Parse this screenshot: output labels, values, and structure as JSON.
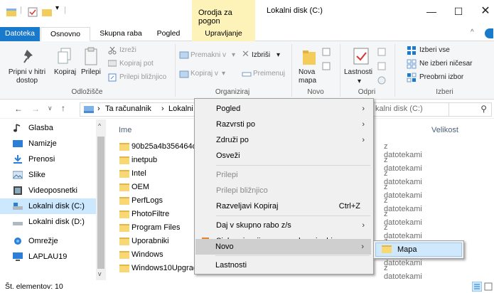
{
  "window": {
    "title": "Lokalni disk (C:)",
    "context_tab_group": "Orodja za pogon"
  },
  "tabs": [
    {
      "label": "Datoteka"
    },
    {
      "label": "Osnovno"
    },
    {
      "label": "Skupna raba"
    },
    {
      "label": "Pogled"
    },
    {
      "label": "Upravljanje"
    }
  ],
  "ribbon": {
    "pin": "Pripni v hitri\ndostop",
    "copy": "Kopiraj",
    "paste": "Prilepi",
    "cut": "Izreži",
    "copy_path": "Kopiraj pot",
    "paste_shortcut": "Prilepi bližnjico",
    "move_to": "Premakni v",
    "copy_to": "Kopiraj v",
    "delete": "Izbriši",
    "rename": "Preimenuj",
    "new_folder": "Nova\nmapa",
    "properties": "Lastnosti",
    "select_all": "Izberi vse",
    "select_none": "Ne izberi ničesar",
    "invert": "Preobrni izbor",
    "groups": {
      "clipboard": "Odložišče",
      "organize": "Organiziraj",
      "new": "Novo",
      "open": "Odpri",
      "select": "Izberi"
    }
  },
  "address": {
    "path_part1": "Ta računalnik",
    "path_part2": "Lokalni disk",
    "search_placeholder": "kalni disk (C:)"
  },
  "nav": {
    "items": [
      {
        "label": "Glasba",
        "icon": "music-icon"
      },
      {
        "label": "Namizje",
        "icon": "desktop-icon"
      },
      {
        "label": "Prenosi",
        "icon": "download-icon"
      },
      {
        "label": "Slike",
        "icon": "pictures-icon"
      },
      {
        "label": "Videoposnetki",
        "icon": "video-icon"
      },
      {
        "label": "Lokalni disk (C:)",
        "icon": "drive-icon",
        "selected": true
      },
      {
        "label": "Lokalni disk (D:)",
        "icon": "drive-icon"
      },
      {
        "label": "Omrežje",
        "icon": "network-icon"
      },
      {
        "label": "LAPLAU19",
        "icon": "computer-icon"
      }
    ]
  },
  "list": {
    "col_name": "Ime",
    "col_size": "Velikost",
    "folder_type": "z datotekami",
    "rows": [
      {
        "name": "90b25a4b356464d0"
      },
      {
        "name": "inetpub"
      },
      {
        "name": "Intel"
      },
      {
        "name": "OEM"
      },
      {
        "name": "PerfLogs"
      },
      {
        "name": "PhotoFiltre"
      },
      {
        "name": "Program Files"
      },
      {
        "name": "Uporabniki"
      },
      {
        "name": "Windows"
      },
      {
        "name": "Windows10Upgrad"
      }
    ]
  },
  "status": {
    "text": "Št. elementov: 10"
  },
  "context_menu": {
    "view": "Pogled",
    "sort_by": "Razvrsti po",
    "group_by": "Združi po",
    "refresh": "Osveži",
    "paste": "Prilepi",
    "paste_shortcut": "Prilepi bližnjico",
    "undo_copy": "Razveljavi Kopiraj",
    "undo_shortcut": "Ctrl+Z",
    "share": "Daj v skupno rabo z/s",
    "sync": "Sinhronizacija mape v skupni rabi",
    "new": "Novo",
    "properties": "Lastnosti"
  },
  "submenu": {
    "folder": "Mapa"
  },
  "colors": {
    "accent": "#1979ca",
    "context_tab": "#fdf2b8",
    "selection": "#cce8ff"
  }
}
